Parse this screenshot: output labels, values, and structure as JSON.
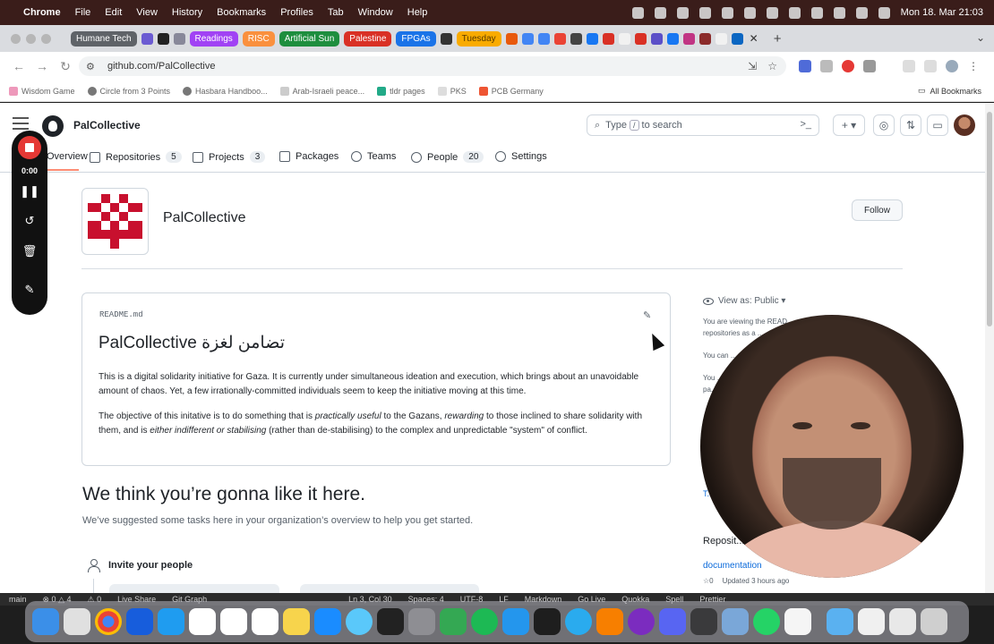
{
  "menubar": {
    "app": "Chrome",
    "items": [
      "File",
      "Edit",
      "View",
      "History",
      "Bookmarks",
      "Profiles",
      "Tab",
      "Window",
      "Help"
    ],
    "datetime": "Mon 18. Mar 21:03"
  },
  "tabs": {
    "groups": [
      {
        "label": "Humane Tech",
        "color": "#5f6368"
      },
      {
        "label": "Readings",
        "color": "#a142f4"
      },
      {
        "label": "RISC",
        "color": "#fa903e"
      },
      {
        "label": "Artificial Sun",
        "color": "#1e8e3e"
      },
      {
        "label": "Palestine",
        "color": "#d93025"
      },
      {
        "label": "FPGAs",
        "color": "#1a73e8"
      },
      {
        "label": "Tuesday",
        "color": "#f9ab00"
      }
    ]
  },
  "address": {
    "url": "github.com/PalCollective"
  },
  "bookmarks": {
    "items": [
      "Wisdom Game",
      "Circle from 3 Points",
      "Hasbara Handboo...",
      "Arab-Israeli peace...",
      "tldr pages",
      "PKS",
      "PCB Germany"
    ],
    "all": "All Bookmarks"
  },
  "header": {
    "org": "PalCollective",
    "search_prefix": "Type",
    "search_key": "/",
    "search_suffix": "to search",
    "plus": "+ ▾"
  },
  "nav": {
    "overview": "Overview",
    "repositories": "Repositories",
    "repositories_count": "5",
    "projects": "Projects",
    "projects_count": "3",
    "packages": "Packages",
    "teams": "Teams",
    "people": "People",
    "people_count": "20",
    "settings": "Settings"
  },
  "profile": {
    "title": "PalCollective",
    "follow": "Follow"
  },
  "readme": {
    "file": "README.md",
    "heading": "PalCollective تضامن لغزة",
    "p1": "This is a digital solidarity initiative for Gaza. It is currently under simultaneous ideation and execution, which brings about an unavoidable amount of chaos. Yet, a few irrationally-committed individuals seem to keep the initiative moving at this time.",
    "p2_a": "The objective of this initative is to do something that is ",
    "p2_b": "practically useful",
    "p2_c": " to the Gazans, ",
    "p2_d": "rewarding",
    "p2_e": " to those inclined to share solidarity with them, and is ",
    "p2_f": "either indifferent or stabilising",
    "p2_g": " (rather than de-stabilising) to the complex and unpredictable \"system\" of conflict."
  },
  "welcome": {
    "title": "We think you’re gonna like it here.",
    "subtitle": "We’ve suggested some tasks here in your organization’s overview to help you get started.",
    "task": "Invite your people"
  },
  "sidebar": {
    "view_as": "View as: Public ▾",
    "line1": "You are viewing the READ...",
    "line2": "repositories as a ...",
    "line3": "You can ...",
    "line4": "You ...",
    "line5": "pa...",
    "stub": "T...",
    "repos_heading": "Reposit...",
    "repo_name": "documentation",
    "repo_stars": "☆0",
    "repo_updated": "Updated 3 hours ago"
  },
  "recorder": {
    "time": "0:00"
  },
  "vscode_status": {
    "items": [
      "main",
      "⊗ 0 △ 4",
      "⚠ 0",
      "Live Share",
      "Git Graph",
      "Ln 3, Col 30",
      "Spaces: 4",
      "UTF-8",
      "LF",
      "Markdown",
      "Go Live",
      "Quokka",
      "Spell",
      "Prettier"
    ]
  },
  "dock": {
    "apps": [
      "Finder",
      "Launchpad",
      "Chrome",
      "Bitwarden",
      "VS Code",
      "Slack",
      "Calendar",
      "Reminders",
      "Notes",
      "App Store",
      "Safari",
      "Terminal",
      "System Settings",
      "Mosaic",
      "Spotify",
      "Docker",
      "Figma",
      "Telegram",
      "Overflow",
      "Recorder",
      "Discord",
      "Calculator",
      "Preview",
      "WhatsApp",
      "TextEdit",
      "Folder",
      "Screenshots",
      "Drive",
      "Trash"
    ]
  }
}
